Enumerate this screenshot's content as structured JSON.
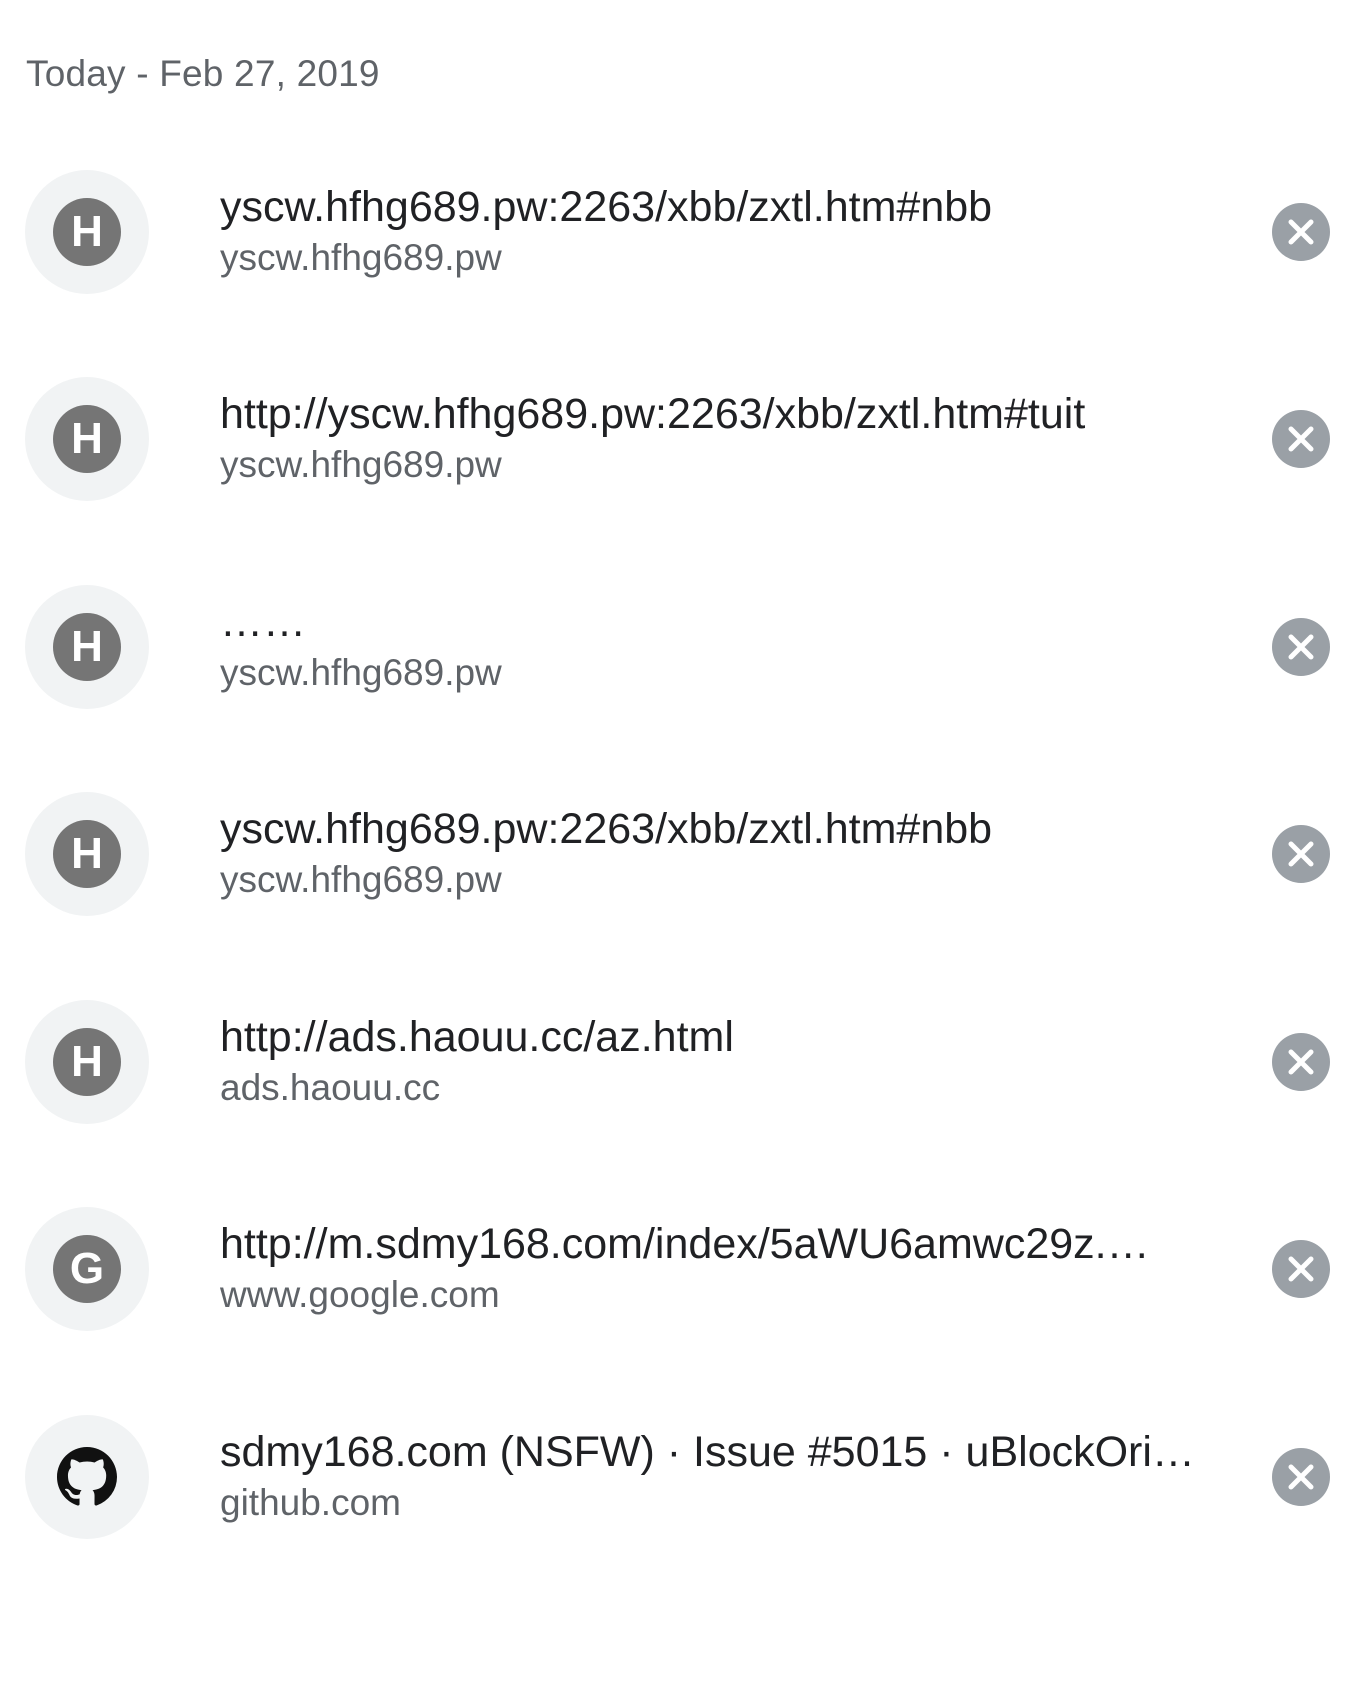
{
  "history": {
    "date_header": "Today - Feb 27, 2019",
    "items": [
      {
        "title": "yscw.hfhg689.pw:2263/xbb/zxtl.htm#nbb",
        "domain": "yscw.hfhg689.pw",
        "icon": "letter-badge",
        "letter": "H"
      },
      {
        "title": "http://yscw.hfhg689.pw:2263/xbb/zxtl.htm#tuit",
        "domain": "yscw.hfhg689.pw",
        "icon": "letter-badge",
        "letter": "H"
      },
      {
        "title": "……",
        "domain": "yscw.hfhg689.pw",
        "icon": "letter-badge",
        "letter": "H"
      },
      {
        "title": "yscw.hfhg689.pw:2263/xbb/zxtl.htm#nbb",
        "domain": "yscw.hfhg689.pw",
        "icon": "letter-badge",
        "letter": "H"
      },
      {
        "title": "http://ads.haouu.cc/az.html",
        "domain": "ads.haouu.cc",
        "icon": "letter-badge",
        "letter": "H"
      },
      {
        "title": "http://m.sdmy168.com/index/5aWU6amwc29z.…",
        "domain": "www.google.com",
        "icon": "letter-badge",
        "letter": "G"
      },
      {
        "title": "sdmy168.com (NSFW) · Issue #5015 · uBlockOri…",
        "domain": "github.com",
        "icon": "github-icon",
        "letter": ""
      }
    ]
  },
  "colors": {
    "title_text": "#202124",
    "secondary_text": "#5f6368",
    "icon_circle_bg": "#f1f3f4",
    "letter_badge_bg": "#757575",
    "remove_button_bg": "#9aa0a6"
  }
}
